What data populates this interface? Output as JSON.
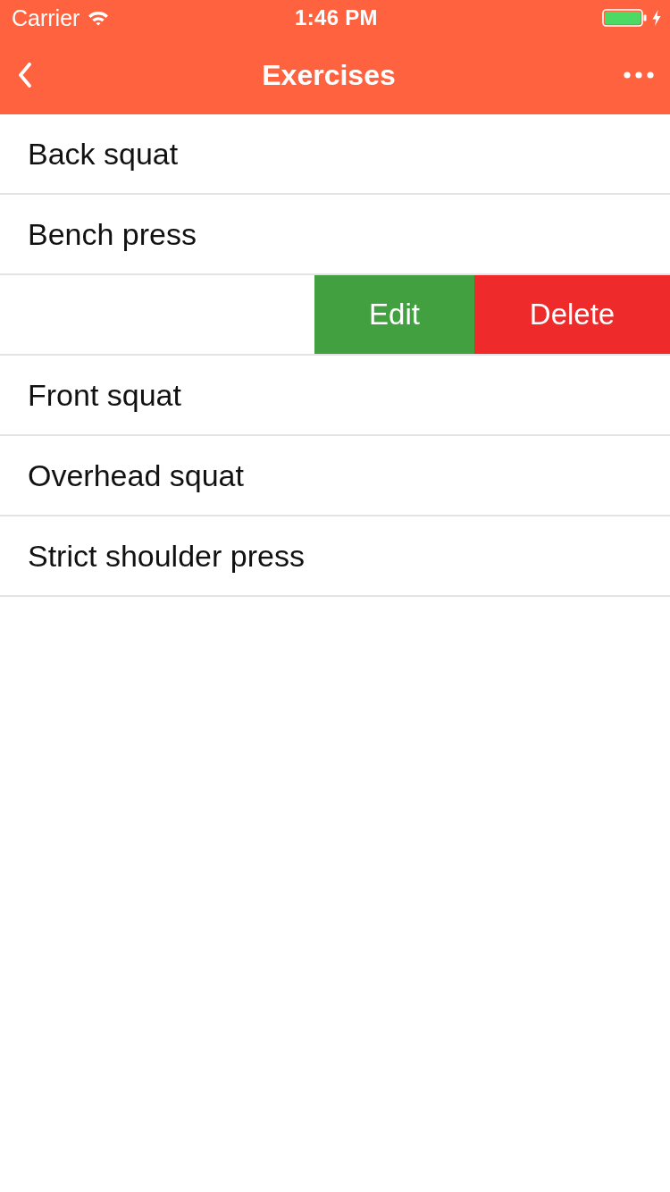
{
  "status_bar": {
    "carrier": "Carrier",
    "time": "1:46 PM",
    "charging": true
  },
  "nav_bar": {
    "title": "Exercises"
  },
  "exercises": [
    {
      "kind": "item",
      "name": "Back squat"
    },
    {
      "kind": "item",
      "name": "Bench press"
    },
    {
      "kind": "swiped",
      "actions": [
        {
          "kind": "edit",
          "label": "Edit"
        },
        {
          "kind": "delete",
          "label": "Delete"
        }
      ]
    },
    {
      "kind": "item",
      "name": "Front squat"
    },
    {
      "kind": "item",
      "name": "Overhead squat"
    },
    {
      "kind": "item",
      "name": "Strict shoulder press"
    }
  ]
}
